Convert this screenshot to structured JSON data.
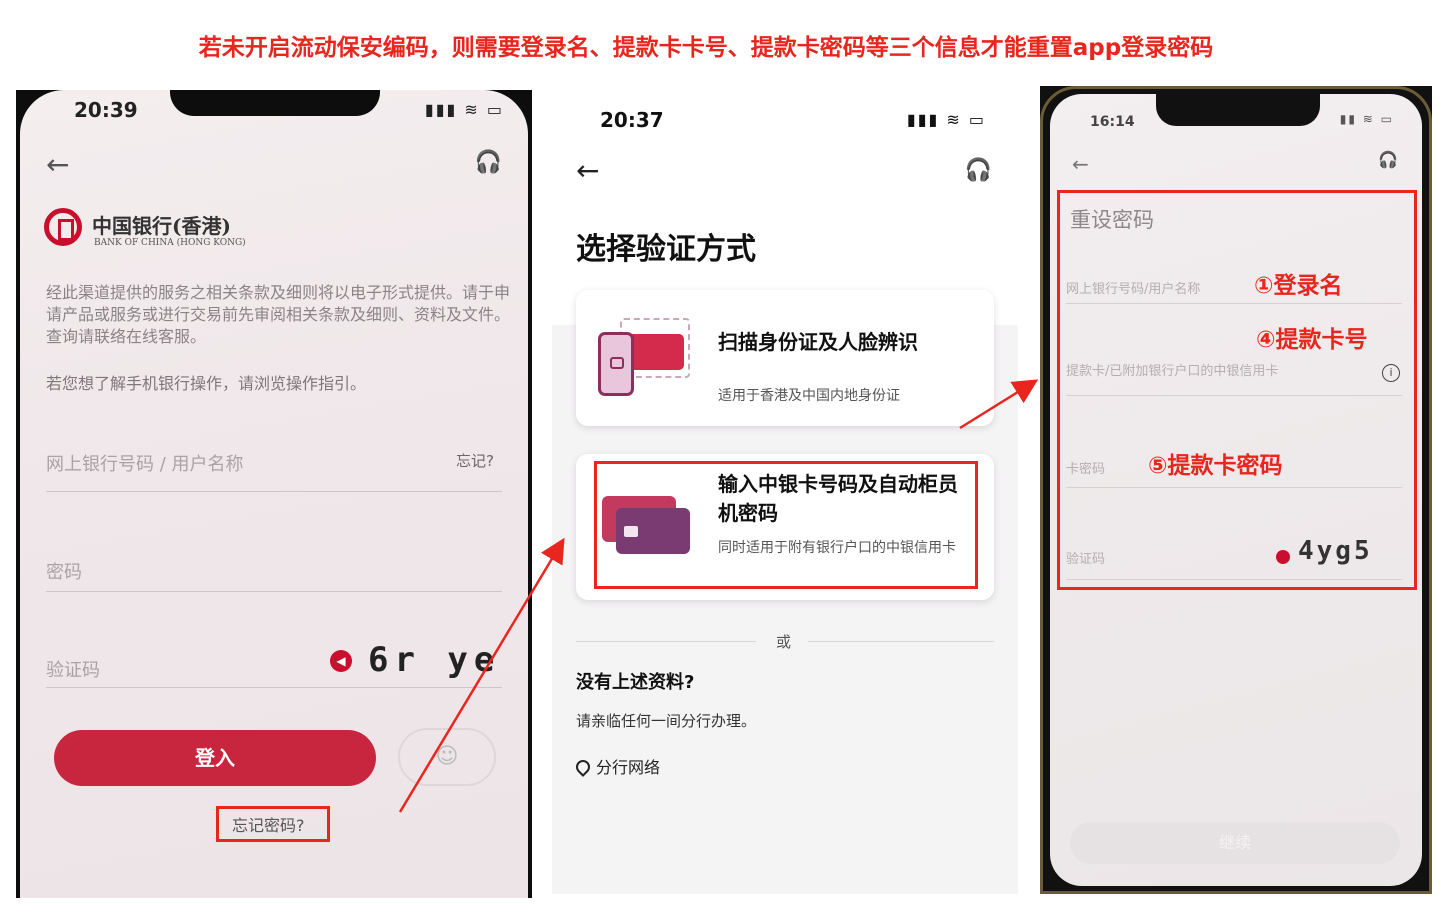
{
  "banner": "若未开启流动保安编码，则需要登录名、提款卡卡号、提款卡密码等三个信息才能重置app登录密码",
  "colors": {
    "annotation": "#e8261d",
    "brand": "#c8102e"
  },
  "phone1": {
    "time": "20:39",
    "status": "▮▮▮ ≋ ▭",
    "logo_cn": "中国银行(香港)",
    "logo_en": "BANK OF CHINA (HONG KONG)",
    "terms": "经此渠道提供的服务之相关条款及细则将以电子形式提供。请于申请产品或服务或进行交易前先审阅相关条款及细则、资料及文件。查询请联络在线客服。",
    "guide": "若您想了解手机银行操作，请浏览操作指引。",
    "username_placeholder": "网上银行号码 / 用户名称",
    "forgot_short": "忘记?",
    "password_placeholder": "密码",
    "captcha_placeholder": "验证码",
    "captcha_code": "6r ye",
    "login_button": "登入",
    "forgot_password": "忘记密码?"
  },
  "phone2": {
    "time": "20:37",
    "status": "▮▮▮ ≋ ▭",
    "title": "选择验证方式",
    "option1": {
      "title": "扫描身份证及人脸辨识",
      "desc": "适用于香港及中国内地身份证"
    },
    "option2": {
      "title": "输入中银卡号码及自动柜员机密码",
      "desc": "同时适用于附有银行户口的中银信用卡"
    },
    "or": "或",
    "no_info_title": "没有上述资料?",
    "no_info_desc": "请亲临任何一间分行办理。",
    "branch_link": "分行网络"
  },
  "phone3": {
    "time": "16:14",
    "status": "▮▮ ≋ ▭",
    "title": "重设密码",
    "field1": "网上银行号码/用户名称",
    "field2": "提款卡/已附加银行户口的中银信用卡",
    "field3": "卡密码",
    "field4": "验证码",
    "captcha_code": "4yg5",
    "continue_button": "继续"
  },
  "annotations": {
    "login_name": "①登录名",
    "card_number": "④提款卡号",
    "card_pin": "⑤提款卡密码"
  }
}
